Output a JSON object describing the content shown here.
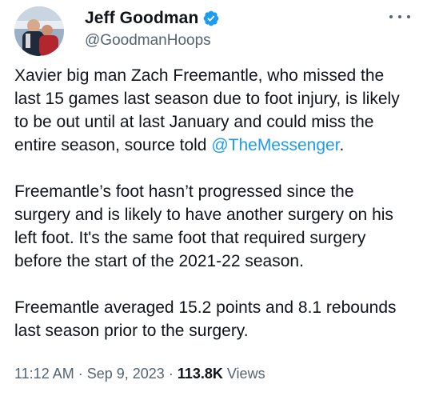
{
  "author": {
    "display_name": "Jeff Goodman",
    "handle": "@GoodmanHoops",
    "verified": true
  },
  "icons": {
    "verified": "verified-badge-icon",
    "more": "more-options-icon"
  },
  "colors": {
    "link": "#1d9bf0",
    "secondary_text": "#536471",
    "primary_text": "#0f1419"
  },
  "tweet": {
    "paragraphs": [
      {
        "before": "Xavier big man Zach Freemantle, who missed the last 15 games last season due to foot injury, is likely to be out until at last January and could miss the entire season, source told ",
        "mention": "@TheMessenger",
        "after": "."
      },
      {
        "text": "Freemantle’s foot hasn’t progressed since the surgery and is likely to have another surgery on his left foot. It's the same foot that required surgery before the start of the 2021-22 season."
      },
      {
        "text": "Freemantle averaged 15.2 points and 8.1 rebounds last season prior to the surgery."
      }
    ]
  },
  "meta": {
    "time": "11:12 AM",
    "separator": " · ",
    "date": "Sep 9, 2023",
    "views_count": "113.8K",
    "views_label": " Views"
  }
}
